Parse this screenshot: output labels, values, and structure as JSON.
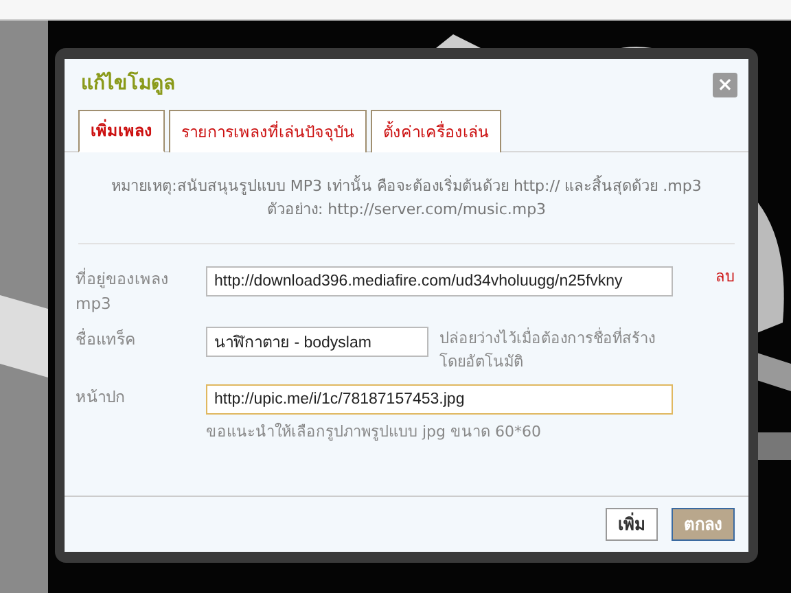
{
  "dialog": {
    "title": "แก้ไขโมดูล",
    "close": "×"
  },
  "tabs": [
    {
      "label": "เพิ่มเพลง",
      "selected": true
    },
    {
      "label": "รายการเพลงที่เล่นปัจจุบัน",
      "selected": false
    },
    {
      "label": "ตั้งค่าเครื่องเล่น",
      "selected": false
    }
  ],
  "note": [
    "หมายเหตุ:สนับสนุนรูปแบบ MP3 เท่านั้น คือจะต้องเริ่มต้นด้วย http:// และสิ้นสุดด้วย .mp3",
    "ตัวอย่าง: http://server.com/music.mp3"
  ],
  "fields": [
    {
      "label": "ที่อยู่ของเพลง mp3",
      "value": "http://download396.mediafire.com/ud34vholuugg/n25fvkny",
      "kind": "wide",
      "focused": false,
      "action": "ลบ"
    },
    {
      "label": "ชื่อแทร็ค",
      "value": "นาฬิกาตาย - bodyslam",
      "kind": "short",
      "focused": false,
      "hint": "ปล่อยว่างไว้เมื่อต้องการชื่อที่สร้างโดยอัตโนมัติ"
    },
    {
      "label": "หน้าปก",
      "value": "http://upic.me/i/1c/78187157453.jpg",
      "kind": "wide",
      "focused": true,
      "hint": "ขอแนะนำให้เลือกรูปภาพรูปแบบ jpg ขนาด 60*60"
    }
  ],
  "buttons": [
    {
      "label": "เพิ่ม",
      "kind": "secondary"
    },
    {
      "label": "ตกลง",
      "kind": "primary"
    }
  ]
}
